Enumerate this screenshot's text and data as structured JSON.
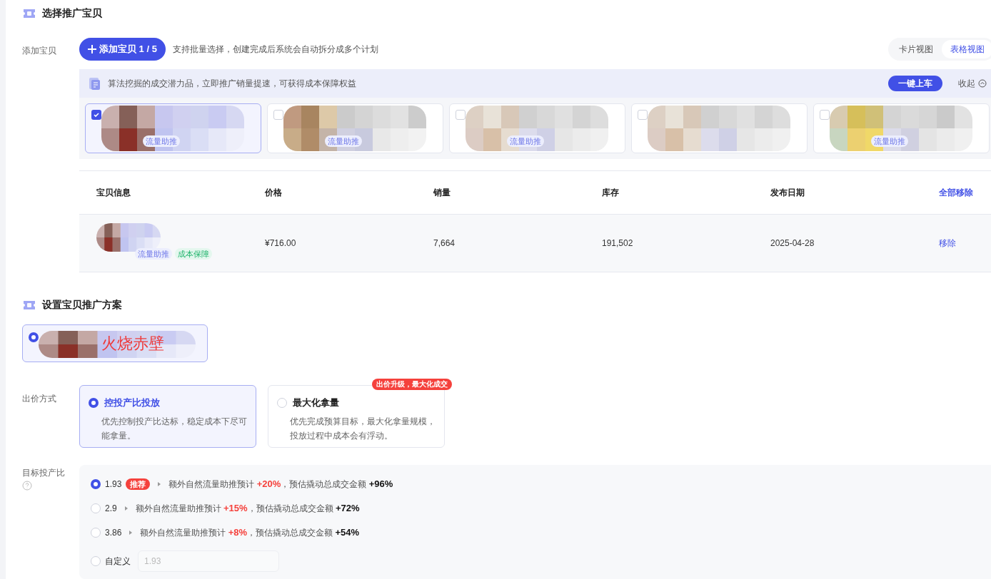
{
  "section1": {
    "title": "选择推广宝贝"
  },
  "add": {
    "label": "添加宝贝",
    "button": "添加宝贝 1 / 5",
    "hint": "支持批量选择，创建完成后系统会自动拆分成多个计划"
  },
  "view_tabs": [
    {
      "label": "卡片视图",
      "selected": false
    },
    {
      "label": "表格视图",
      "selected": true
    }
  ],
  "recommend": {
    "text": "算法挖掘的成交潜力品，立即推广销量提速，可获得成本保障权益",
    "button": "一键上车",
    "collapse": "收起"
  },
  "cards": [
    {
      "checked": true,
      "tag": "流量助推"
    },
    {
      "checked": false,
      "tag": "流量助推"
    },
    {
      "checked": false,
      "tag": "流量助推"
    },
    {
      "checked": false
    },
    {
      "checked": false,
      "tag": "流量助推"
    }
  ],
  "table": {
    "columns": [
      "宝贝信息",
      "价格",
      "销量",
      "库存",
      "发布日期"
    ],
    "action_header": "全部移除",
    "rows": [
      {
        "tags": [
          {
            "label": "流量助推",
            "kind": "traffic"
          },
          {
            "label": "成本保障",
            "kind": "cost"
          }
        ],
        "price": "¥716.00",
        "sales": "7,664",
        "stock": "191,502",
        "date": "2025-04-28",
        "action": "移除"
      }
    ]
  },
  "section2": {
    "title": "设置宝贝推广方案"
  },
  "plan": {
    "selected": true,
    "overlay_text": "火烧赤壁"
  },
  "bid": {
    "label": "出价方式",
    "options": [
      {
        "title": "控投产比投放",
        "desc": "优先控制投产比达标，稳定成本下尽可能拿量。",
        "selected": true
      },
      {
        "title": "最大化拿量",
        "desc": "优先完成预算目标，最大化拿量规模，投放过程中成本会有浮动。",
        "selected": false,
        "badge": "出价升级，最大化成交"
      }
    ]
  },
  "roi": {
    "label": "目标投产比",
    "options": [
      {
        "kind": "preset",
        "value": "1.93",
        "badge": "推荐",
        "text_a": "额外自然流量助推预计",
        "boost": "+20%",
        "text_b": "，预估撬动总成交金额",
        "gmv": "+96%",
        "selected": true
      },
      {
        "kind": "preset",
        "value": "2.9",
        "text_a": "额外自然流量助推预计",
        "boost": "+15%",
        "text_b": "，预估撬动总成交金额",
        "gmv": "+72%",
        "selected": false
      },
      {
        "kind": "preset",
        "value": "3.86",
        "text_a": "额外自然流量助推预计",
        "boost": "+8%",
        "text_b": "，预估撬动总成交金额",
        "gmv": "+54%",
        "selected": false
      },
      {
        "kind": "custom",
        "value": "自定义",
        "placeholder": "1.93",
        "selected": false
      }
    ]
  }
}
